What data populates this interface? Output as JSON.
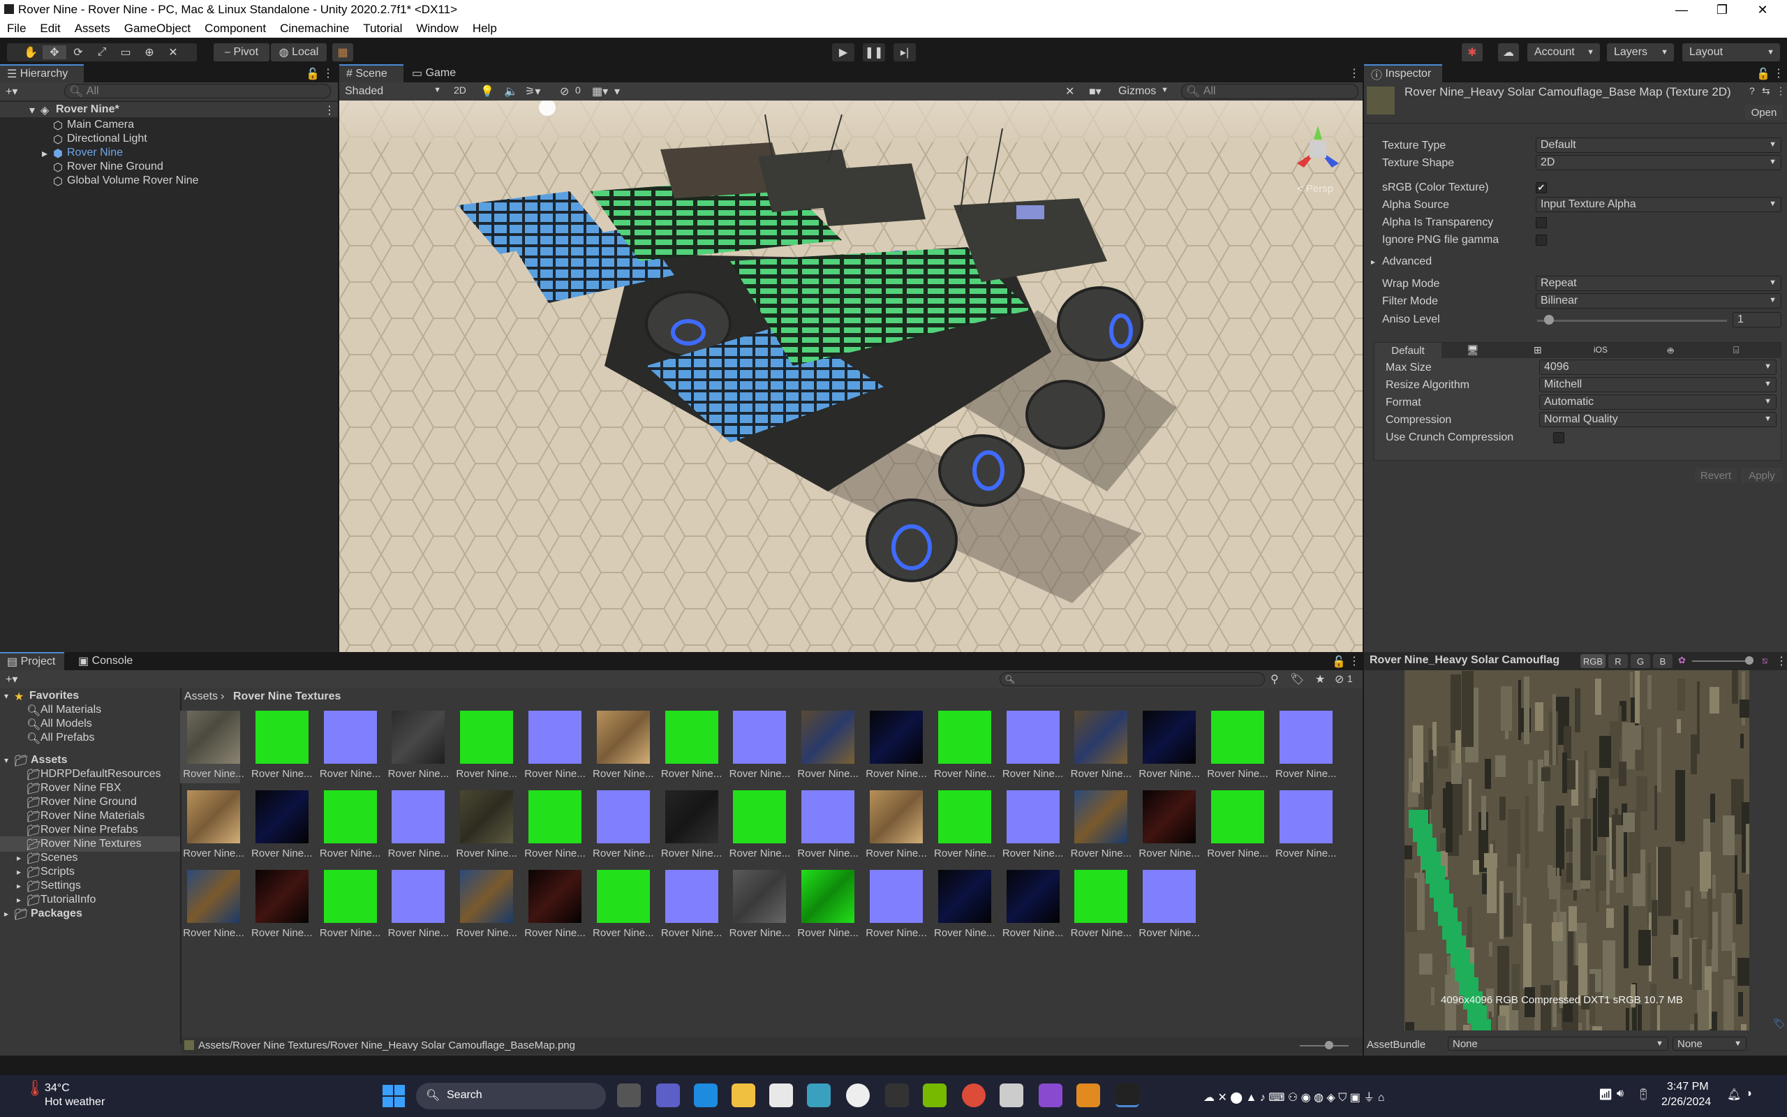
{
  "window": {
    "title": "Rover Nine - Rover Nine - PC, Mac & Linux Standalone - Unity 2020.2.7f1* <DX11>",
    "controls": [
      "—",
      "❐",
      "✕"
    ]
  },
  "menu": [
    "File",
    "Edit",
    "Assets",
    "GameObject",
    "Component",
    "Cinemachine",
    "Tutorial",
    "Window",
    "Help"
  ],
  "toolbar": {
    "pivot_label": "Pivot",
    "local_label": "Local",
    "account_label": "Account",
    "layers_label": "Layers",
    "layout_label": "Layout"
  },
  "hierarchy": {
    "tab": "Hierarchy",
    "search_placeholder": "All",
    "scene_name": "Rover Nine*",
    "items": [
      "Main Camera",
      "Directional Light",
      "Rover Nine",
      "Rover Nine Ground",
      "Global Volume Rover Nine"
    ]
  },
  "scene": {
    "tabs": [
      "Scene",
      "Game"
    ],
    "draw_mode": "Shaded",
    "mode_2d": "2D",
    "hidden_count": "0",
    "gizmos_label": "Gizmos",
    "search_placeholder": "All",
    "persp_label": "< Persp"
  },
  "inspector": {
    "tab": "Inspector",
    "asset_title": "Rover Nine_Heavy Solar Camouflage_Base Map (Texture 2D)",
    "open_button": "Open",
    "props": [
      {
        "label": "Texture Type",
        "value": "Default"
      },
      {
        "label": "Texture Shape",
        "value": "2D"
      }
    ],
    "srgb_label": "sRGB (Color Texture)",
    "alpha_source_label": "Alpha Source",
    "alpha_source_value": "Input Texture Alpha",
    "alpha_transparency_label": "Alpha Is Transparency",
    "ignore_png_label": "Ignore PNG file gamma",
    "advanced_label": "Advanced",
    "wrap_mode_label": "Wrap Mode",
    "wrap_mode_value": "Repeat",
    "filter_mode_label": "Filter Mode",
    "filter_mode_value": "Bilinear",
    "aniso_label": "Aniso Level",
    "aniso_value": "1",
    "aniso_level": 1,
    "platform_tab_default": "Default",
    "platform_tab_ios": "iOS",
    "platform_props": [
      {
        "label": "Max Size",
        "value": "4096"
      },
      {
        "label": "Resize Algorithm",
        "value": "Mitchell"
      },
      {
        "label": "Format",
        "value": "Automatic"
      },
      {
        "label": "Compression",
        "value": "Normal Quality"
      }
    ],
    "crunch_label": "Use Crunch Compression",
    "revert_button": "Revert",
    "apply_button": "Apply"
  },
  "preview": {
    "title": "Rover Nine_Heavy Solar Camouflag",
    "channels": [
      "RGB",
      "R",
      "G",
      "B"
    ],
    "info": "4096x4096  RGB Compressed DXT1 sRGB  10.7 MB",
    "assetbundle_label": "AssetBundle",
    "assetbundle_value": "None",
    "variant_value": "None"
  },
  "project": {
    "tabs": [
      "Project",
      "Console"
    ],
    "favorites_label": "Favorites",
    "favorites": [
      "All Materials",
      "All Models",
      "All Prefabs"
    ],
    "assets_label": "Assets",
    "folders": [
      "HDRPDefaultResources",
      "Rover Nine FBX",
      "Rover Nine Ground",
      "Rover Nine Materials",
      "Rover Nine Prefabs",
      "Rover Nine Textures",
      "Scenes",
      "Scripts",
      "Settings",
      "TutorialInfo"
    ],
    "packages_label": "Packages",
    "breadcrumb": [
      "Assets",
      "Rover Nine Textures"
    ],
    "hidden_count": "1",
    "asset_label": "Rover Nine...",
    "asset_thumbs": [
      "camo",
      "green",
      "blue",
      "darkcamo",
      "green",
      "blue",
      "tan",
      "green",
      "blue",
      "camoblue",
      "darkblue",
      "green",
      "blue",
      "camoblue",
      "darkblue",
      "green",
      "blue",
      "tan",
      "darkblue",
      "green",
      "blue",
      "olive",
      "green",
      "blue",
      "dark",
      "green",
      "blue",
      "tan",
      "green",
      "blue",
      "bluecamo",
      "darkred",
      "green",
      "blue",
      "bluecamo",
      "darkred",
      "green",
      "blue",
      "bluecamo",
      "darkred",
      "green",
      "blue",
      "grey",
      "greenmap",
      "blue",
      "darkblue",
      "darkblue",
      "green",
      "blue"
    ],
    "status_path": "Assets/Rover Nine Textures/Rover Nine_Heavy Solar Camouflage_BaseMap.png"
  },
  "taskbar": {
    "weather_temp": "34°C",
    "weather_desc": "Hot weather",
    "search_label": "Search",
    "time": "3:47 PM",
    "date": "2/26/2024"
  },
  "colors": {
    "accent": "#4a8bd6",
    "thumb_green": "#22e01a",
    "thumb_blue": "#8080ff"
  }
}
